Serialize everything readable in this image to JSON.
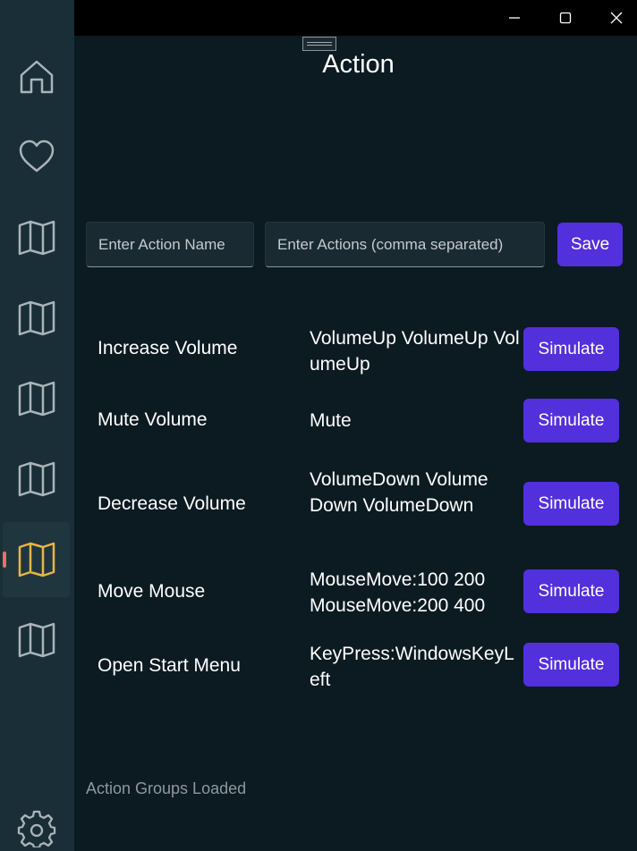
{
  "window": {
    "minimize_icon": "minimize-icon",
    "maximize_icon": "maximize-icon",
    "close_icon": "close-icon"
  },
  "sidebar": {
    "items": [
      {
        "icon": "home-icon"
      },
      {
        "icon": "heart-icon"
      },
      {
        "icon": "map-icon"
      },
      {
        "icon": "map-icon"
      },
      {
        "icon": "map-icon"
      },
      {
        "icon": "map-icon"
      },
      {
        "icon": "map-icon",
        "selected": true
      },
      {
        "icon": "map-icon"
      }
    ],
    "settings_icon": "gear-icon",
    "accent_color": "#e8b44a",
    "selection_indicator_color": "#e8706a"
  },
  "page": {
    "title": "Action"
  },
  "form": {
    "name_placeholder": "Enter Action Name",
    "name_value": "",
    "actions_placeholder": "Enter Actions (comma separated)",
    "actions_value": "",
    "save_label": "Save"
  },
  "actions": [
    {
      "name": "Increase Volume",
      "keys": "VolumeUp VolumeUp VolumeUp",
      "button": "Simulate"
    },
    {
      "name": "Mute Volume",
      "keys": "Mute",
      "button": "Simulate"
    },
    {
      "name": "Decrease Volume",
      "keys": "VolumeDown VolumeDown VolumeDown",
      "button": "Simulate"
    },
    {
      "name": "Move Mouse",
      "keys": "MouseMove:100 200 MouseMove:200 400",
      "button": "Simulate"
    },
    {
      "name": "Open Start Menu",
      "keys": "KeyPress:WindowsKeyLeft",
      "button": "Simulate"
    }
  ],
  "status": "Action Groups Loaded",
  "colors": {
    "button": "#5230dc",
    "background": "#0c1a22",
    "sidebar": "#1a2e38"
  }
}
